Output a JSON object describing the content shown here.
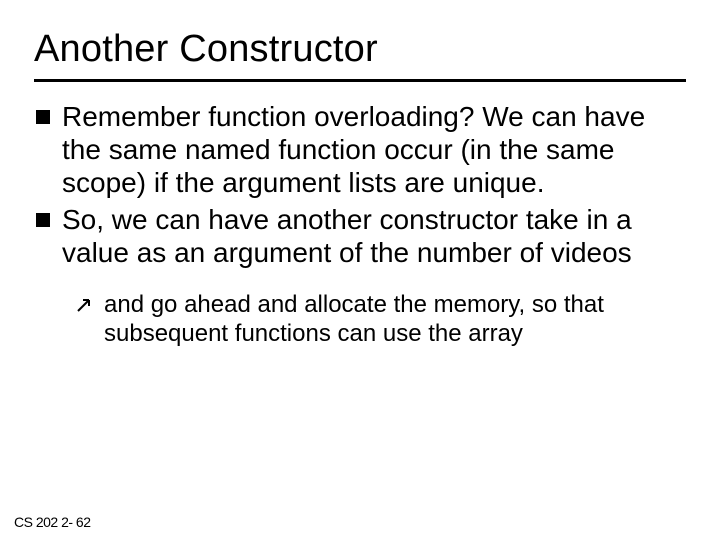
{
  "title": "Another Constructor",
  "bullets": [
    {
      "text": "Remember function overloading? We can have the same named function occur (in the same scope) if the argument lists are unique."
    },
    {
      "text": "So, we can have another constructor take in a value as an argument of the number of videos"
    }
  ],
  "subbullet": {
    "text": "and go ahead and allocate the memory,  so that subsequent functions can use the array"
  },
  "footer": "CS 202   2- 62"
}
